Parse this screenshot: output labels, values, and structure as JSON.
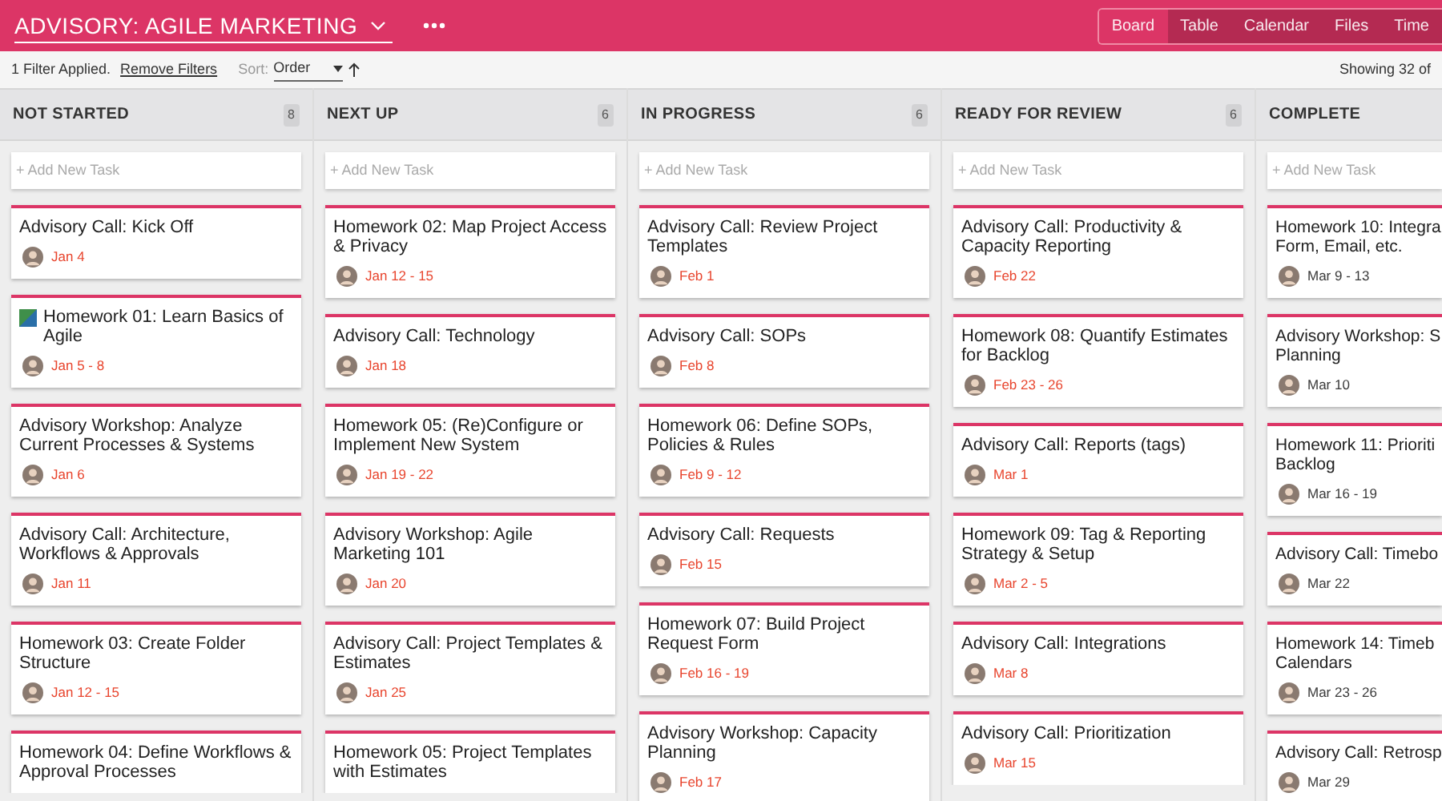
{
  "project": {
    "title": "ADVISORY: AGILE MARKETING"
  },
  "view_tabs": [
    {
      "label": "Board",
      "selected": true
    },
    {
      "label": "Table",
      "selected": false
    },
    {
      "label": "Calendar",
      "selected": false
    },
    {
      "label": "Files",
      "selected": false
    },
    {
      "label": "Time",
      "selected": false
    }
  ],
  "filter_bar": {
    "filter_text": "1 Filter Applied.",
    "remove_link": "Remove Filters",
    "sort_label": "Sort:",
    "sort_value": "Order",
    "showing": "Showing 32 of"
  },
  "columns": [
    {
      "name": "NOT STARTED",
      "count": "8",
      "add_placeholder": "+ Add New Task",
      "cards": [
        {
          "title": "Advisory Call: Kick Off",
          "date": "Jan 4",
          "overdue": true,
          "icon": false
        },
        {
          "title": "Homework 01: Learn Basics of Agile",
          "date": "Jan 5 - 8",
          "overdue": true,
          "icon": true
        },
        {
          "title": "Advisory Workshop: Analyze Current Processes & Systems",
          "date": "Jan 6",
          "overdue": true,
          "icon": false
        },
        {
          "title": "Advisory Call: Architecture, Workflows & Approvals",
          "date": "Jan 11",
          "overdue": true,
          "icon": false
        },
        {
          "title": "Homework 03: Create Folder Structure",
          "date": "Jan 12 - 15",
          "overdue": true,
          "icon": false
        },
        {
          "title": "Homework 04: Define Workflows & Approval Processes",
          "icon": false
        }
      ]
    },
    {
      "name": "NEXT UP",
      "count": "6",
      "add_placeholder": "+ Add New Task",
      "cards": [
        {
          "title": "Homework 02: Map Project Access & Privacy",
          "date": "Jan 12 - 15",
          "overdue": true,
          "icon": false
        },
        {
          "title": "Advisory Call: Technology",
          "date": "Jan 18",
          "overdue": true,
          "icon": false
        },
        {
          "title": "Homework 05: (Re)Configure or Implement New System",
          "date": "Jan 19 - 22",
          "overdue": true,
          "icon": false
        },
        {
          "title": "Advisory Workshop: Agile Marketing 101",
          "date": "Jan 20",
          "overdue": true,
          "icon": false
        },
        {
          "title": "Advisory Call: Project Templates & Estimates",
          "date": "Jan 25",
          "overdue": true,
          "icon": false
        },
        {
          "title": "Homework 05: Project Templates with Estimates",
          "icon": false
        }
      ]
    },
    {
      "name": "IN PROGRESS",
      "count": "6",
      "add_placeholder": "+ Add New Task",
      "cards": [
        {
          "title": "Advisory Call: Review Project Templates",
          "date": "Feb 1",
          "overdue": true,
          "icon": false
        },
        {
          "title": "Advisory Call: SOPs",
          "date": "Feb 8",
          "overdue": true,
          "icon": false
        },
        {
          "title": "Homework 06: Define SOPs, Policies & Rules",
          "date": "Feb 9 - 12",
          "overdue": true,
          "icon": false
        },
        {
          "title": "Advisory Call: Requests",
          "date": "Feb 15",
          "overdue": true,
          "icon": false
        },
        {
          "title": "Homework 07: Build Project Request Form",
          "date": "Feb 16 - 19",
          "overdue": true,
          "icon": false
        },
        {
          "title": "Advisory Workshop: Capacity Planning",
          "date": "Feb 17",
          "overdue": true,
          "icon": false
        }
      ]
    },
    {
      "name": "READY FOR REVIEW",
      "count": "6",
      "add_placeholder": "+ Add New Task",
      "cards": [
        {
          "title": "Advisory Call: Productivity & Capacity Reporting",
          "date": "Feb 22",
          "overdue": true,
          "icon": false
        },
        {
          "title": "Homework 08: Quantify Estimates for Backlog",
          "date": "Feb 23 - 26",
          "overdue": true,
          "icon": false
        },
        {
          "title": "Advisory Call: Reports (tags)",
          "date": "Mar 1",
          "overdue": true,
          "icon": false
        },
        {
          "title": "Homework 09: Tag & Reporting Strategy & Setup",
          "date": "Mar 2 - 5",
          "overdue": true,
          "icon": false
        },
        {
          "title": "Advisory Call: Integrations",
          "date": "Mar 8",
          "overdue": true,
          "icon": false
        },
        {
          "title": "Advisory Call: Prioritization",
          "date": "Mar 15",
          "overdue": true,
          "icon": false
        }
      ]
    },
    {
      "name": "COMPLETE",
      "add_placeholder": "+ Add New Task",
      "cards": [
        {
          "title": "Homework 10: Integra\nForm, Email, etc.",
          "date": "Mar 9 - 13",
          "overdue": false,
          "icon": false
        },
        {
          "title": "Advisory Workshop: S\nPlanning",
          "date": "Mar 10",
          "overdue": false,
          "icon": false
        },
        {
          "title": "Homework 11: Prioriti\nBacklog",
          "date": "Mar 16 - 19",
          "overdue": false,
          "icon": false
        },
        {
          "title": "Advisory Call: Timebo",
          "date": "Mar 22",
          "overdue": false,
          "icon": false
        },
        {
          "title": "Homework 14: Timeb\nCalendars",
          "date": "Mar 23 - 26",
          "overdue": false,
          "icon": false
        },
        {
          "title": "Advisory Call: Retrosp",
          "date": "Mar 29",
          "overdue": false,
          "icon": false
        }
      ]
    }
  ]
}
